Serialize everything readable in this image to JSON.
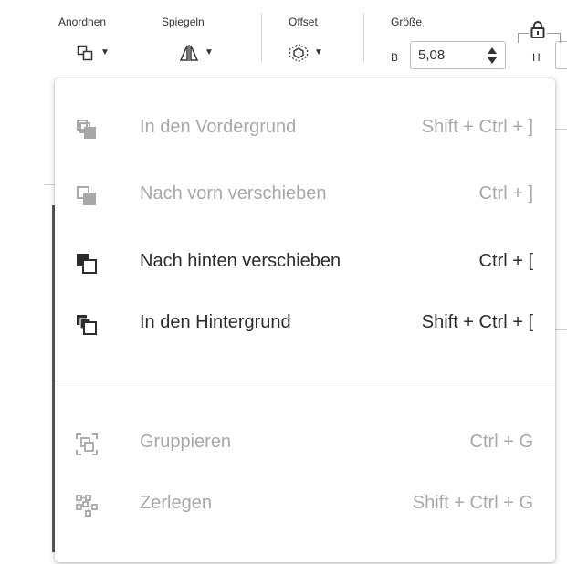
{
  "toolbar": {
    "arrange": {
      "label": "Anordnen",
      "icon": "arrange-icon"
    },
    "mirror": {
      "label": "Spiegeln",
      "icon": "mirror-icon"
    },
    "offset": {
      "label": "Offset",
      "icon": "offset-icon"
    },
    "size": {
      "label": "Größe",
      "width_prefix": "B",
      "width_value": "5,08",
      "height_prefix": "H",
      "lock_icon": "lock-icon"
    }
  },
  "menu": {
    "items": [
      {
        "label": "In den Vordergrund",
        "shortcut": "Shift + Ctrl + ]",
        "icon": "bring-to-front-icon",
        "enabled": false
      },
      {
        "label": "Nach vorn verschieben",
        "shortcut": "Ctrl + ]",
        "icon": "bring-forward-icon",
        "enabled": false
      },
      {
        "label": "Nach hinten verschieben",
        "shortcut": "Ctrl + [",
        "icon": "send-backward-icon",
        "enabled": true
      },
      {
        "label": "In den Hintergrund",
        "shortcut": "Shift + Ctrl + [",
        "icon": "send-to-back-icon",
        "enabled": true
      },
      {
        "label": "Gruppieren",
        "shortcut": "Ctrl + G",
        "icon": "group-icon",
        "enabled": false
      },
      {
        "label": "Zerlegen",
        "shortcut": "Shift + Ctrl + G",
        "icon": "ungroup-icon",
        "enabled": false
      }
    ]
  },
  "colors": {
    "enabled_text": "#2c2c2c",
    "disabled_text": "#a8a8a8"
  }
}
